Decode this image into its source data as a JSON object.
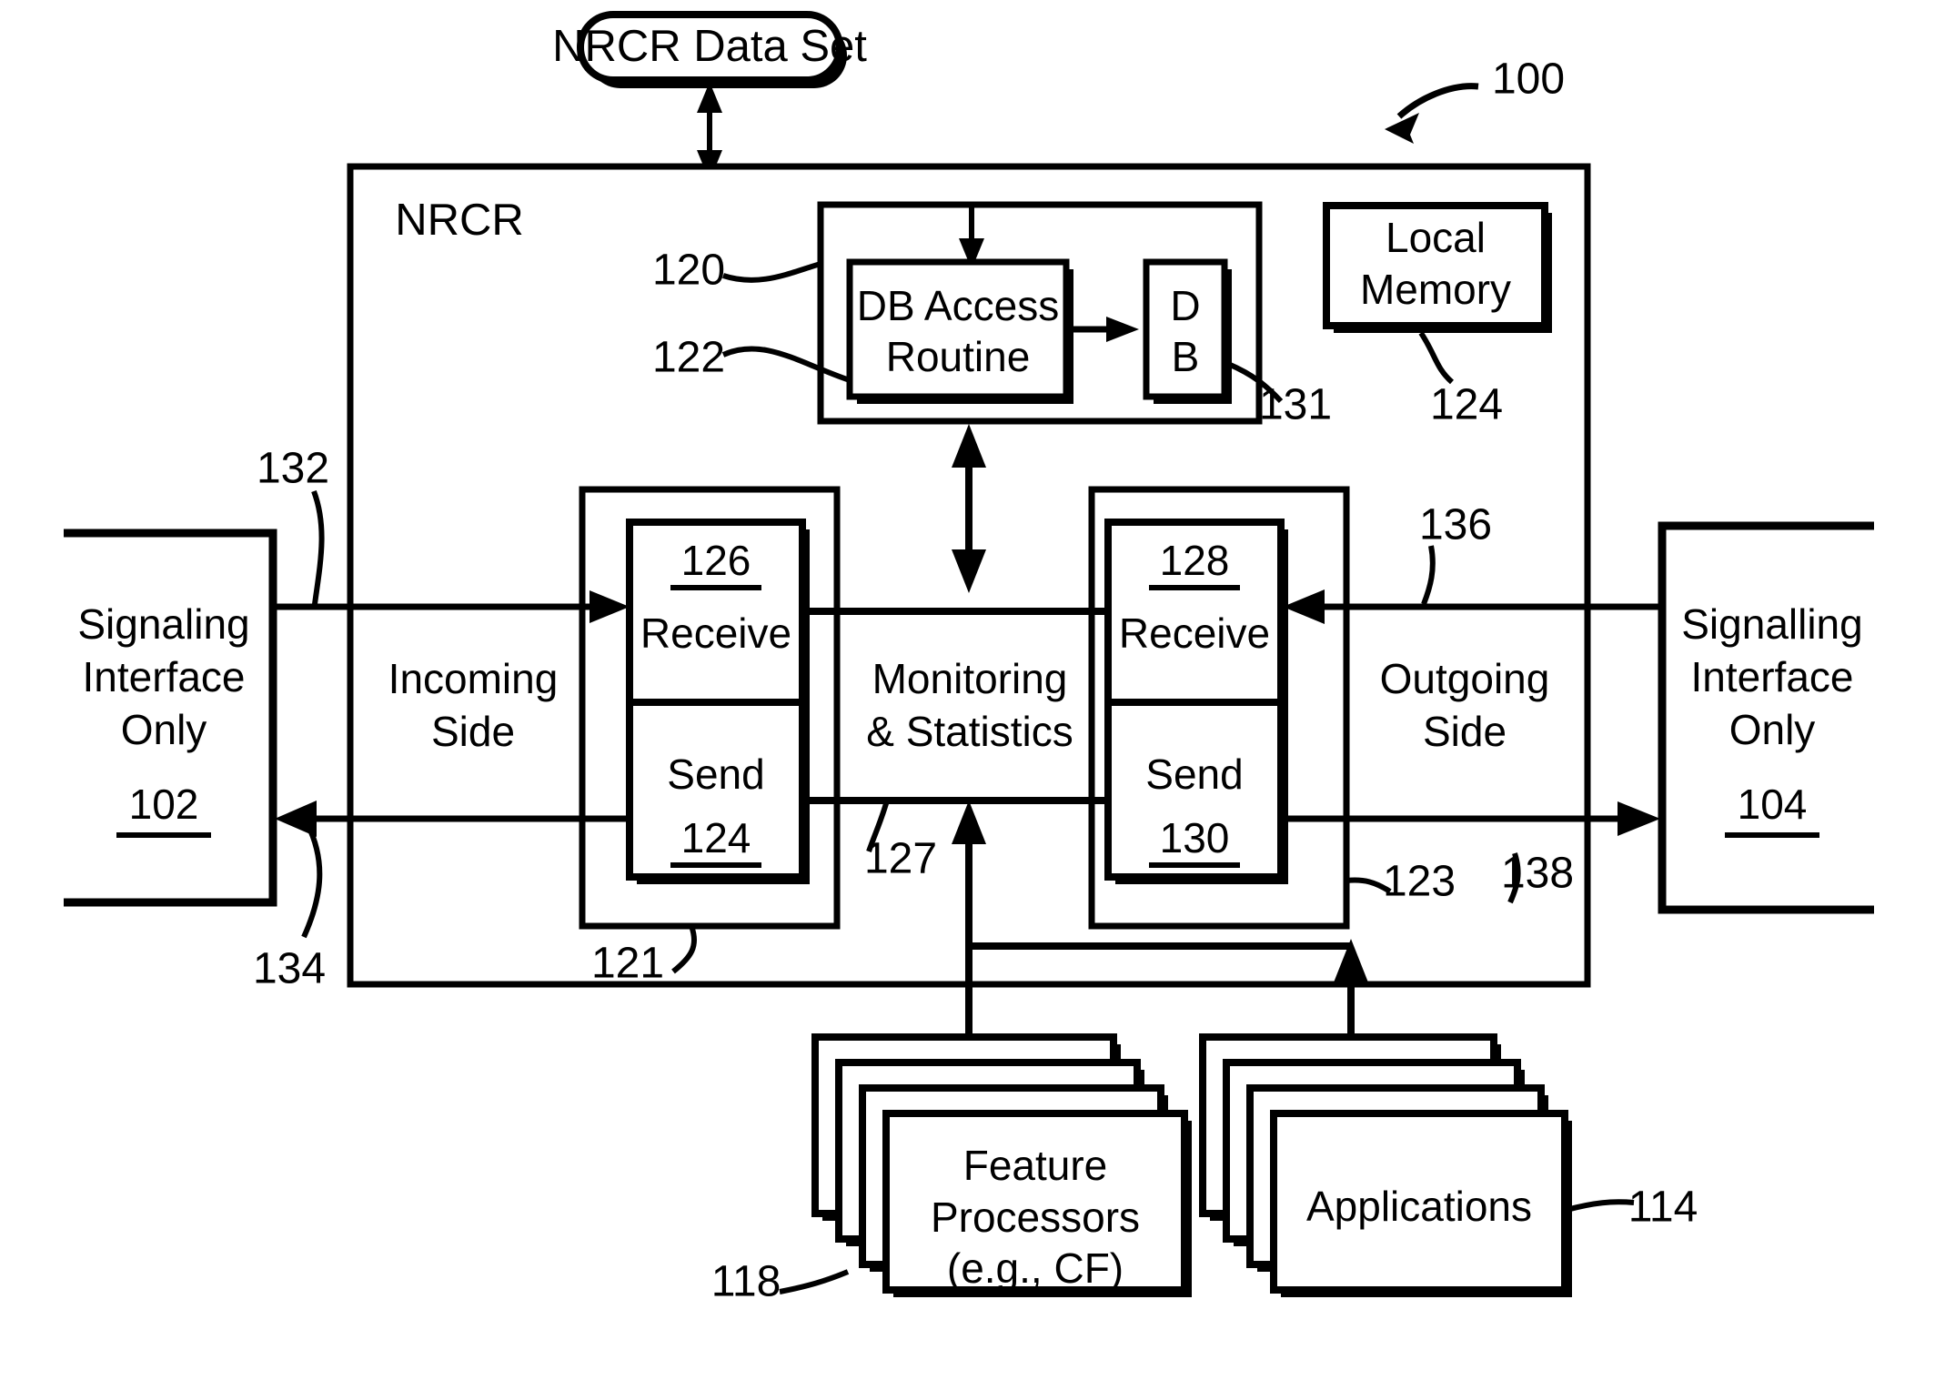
{
  "figure": {
    "reference_numeral": "100",
    "system_label": "NRCR",
    "data_set": "NRCR Data Set"
  },
  "blocks": {
    "db_group_ref": "120",
    "db_access_routine": "DB Access Routine",
    "db_access_routine_line1": "DB Access",
    "db_access_routine_line2": "Routine",
    "db_access_routine_ref": "122",
    "db": "D B",
    "db_line1": "D",
    "db_line2": "B",
    "db_ref": "131",
    "local_memory_line1": "Local",
    "local_memory_line2": "Memory",
    "local_memory_ref": "124",
    "incoming_side_line1": "Incoming",
    "incoming_side_line2": "Side",
    "incoming_group_ref": "121",
    "outgoing_side_line1": "Outgoing",
    "outgoing_side_line2": "Side",
    "outgoing_group_ref": "123",
    "monitoring_line1": "Monitoring",
    "monitoring_line2": "& Statistics",
    "monitoring_ref": "127",
    "left_receive_ref": "126",
    "left_receive_label": "Receive",
    "left_send_label": "Send",
    "left_send_ref": "124",
    "right_receive_ref": "128",
    "right_receive_label": "Receive",
    "right_send_label": "Send",
    "right_send_ref": "130",
    "signaling_interface_left_line1": "Signaling",
    "signaling_interface_left_line2": "Interface",
    "signaling_interface_left_line3": "Only",
    "signaling_interface_left_ref": "102",
    "signaling_interface_right_line1": "Signalling",
    "signaling_interface_right_line2": "Interface",
    "signaling_interface_right_line3": "Only",
    "signaling_interface_right_ref": "104",
    "feature_processors_line1": "Feature",
    "feature_processors_line2": "Processors",
    "feature_processors_line3": "(e.g., CF)",
    "feature_processors_ref": "118",
    "applications_label": "Applications",
    "applications_ref": "114"
  },
  "connector_refs": {
    "incoming_in": "132",
    "incoming_out": "134",
    "outgoing_in": "136",
    "outgoing_out": "138"
  },
  "colors": {
    "ink": "#000000",
    "paper": "#ffffff"
  }
}
